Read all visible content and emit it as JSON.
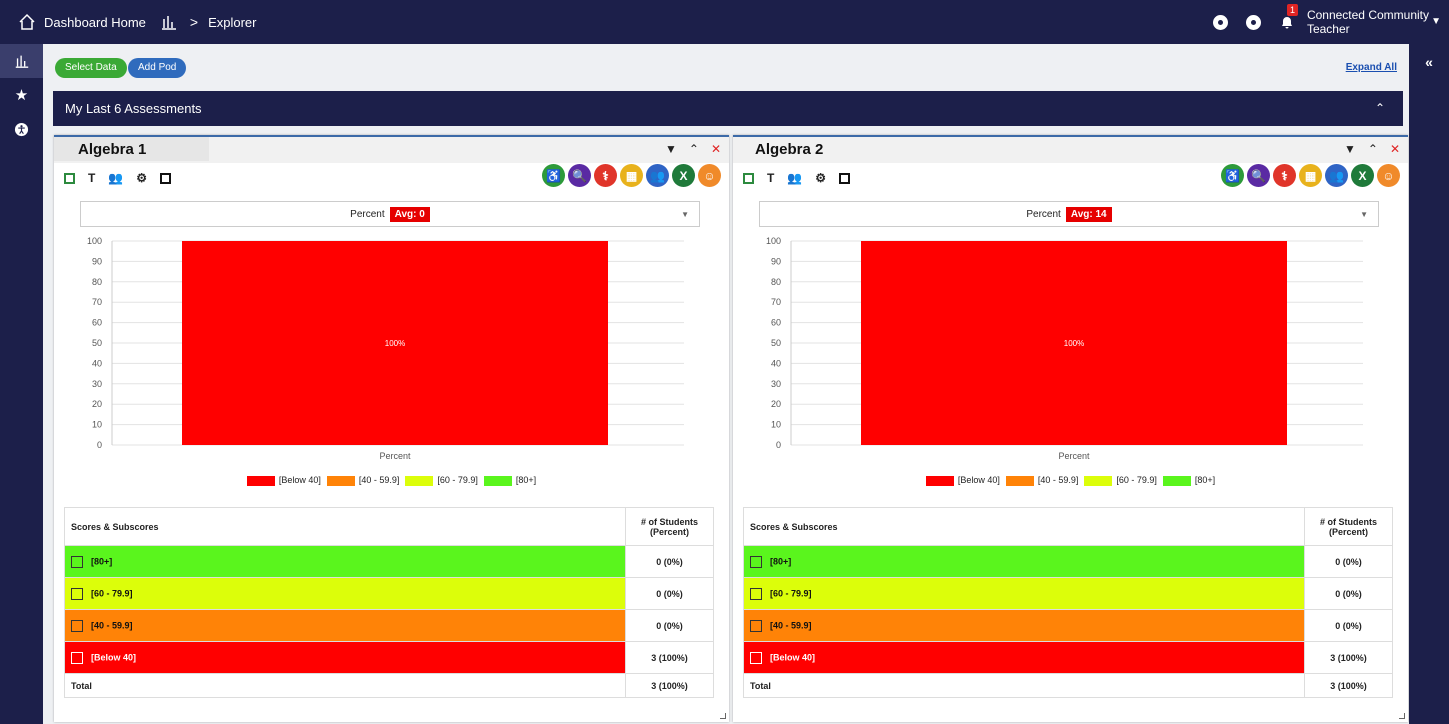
{
  "topbar": {
    "home_label": "Dashboard Home",
    "chevron": ">",
    "current": "Explorer",
    "notification_count": "1",
    "user_line1": "Connected Community",
    "user_line2": "Teacher"
  },
  "content": {
    "select_data_label": "Select Data",
    "add_pod_label": "Add Pod",
    "expand_all_label": "Expand All",
    "section_title": "My Last 6 Assessments"
  },
  "pods": [
    {
      "title": "Algebra 1",
      "dropdown_label": "Percent",
      "avg_label": "Avg: 0",
      "table": {
        "col1": "Scores & Subscores",
        "col2_line1": "# of Students",
        "col2_line2": "(Percent)",
        "rows": [
          {
            "label": "[80+]",
            "value": "0 (0%)",
            "color": "#5af51d"
          },
          {
            "label": "[60 - 79.9]",
            "value": "0 (0%)",
            "color": "#dcfe0a"
          },
          {
            "label": "[40 - 59.9]",
            "value": "0 (0%)",
            "color": "#ff8307"
          },
          {
            "label": "[Below 40]",
            "value": "3 (100%)",
            "color": "#ff0000"
          }
        ],
        "total_label": "Total",
        "total_value": "3 (100%)"
      }
    },
    {
      "title": "Algebra 2",
      "dropdown_label": "Percent",
      "avg_label": "Avg: 14",
      "table": {
        "col1": "Scores & Subscores",
        "col2_line1": "# of Students",
        "col2_line2": "(Percent)",
        "rows": [
          {
            "label": "[80+]",
            "value": "0 (0%)",
            "color": "#5af51d"
          },
          {
            "label": "[60 - 79.9]",
            "value": "0 (0%)",
            "color": "#dcfe0a"
          },
          {
            "label": "[40 - 59.9]",
            "value": "0 (0%)",
            "color": "#ff8307"
          },
          {
            "label": "[Below 40]",
            "value": "3 (100%)",
            "color": "#ff0000"
          }
        ],
        "total_label": "Total",
        "total_value": "3 (100%)"
      }
    }
  ],
  "legend": [
    {
      "label": "[Below 40]",
      "color": "#ff0000"
    },
    {
      "label": "[40 - 59.9]",
      "color": "#ff8307"
    },
    {
      "label": "[60 - 79.9]",
      "color": "#dcfe0a"
    },
    {
      "label": "[80+]",
      "color": "#5af51d"
    }
  ],
  "chart_data": [
    {
      "type": "bar",
      "categories": [
        "Percent"
      ],
      "series": [
        {
          "name": "[Below 40]",
          "values": [
            100
          ]
        },
        {
          "name": "[40 - 59.9]",
          "values": [
            0
          ]
        },
        {
          "name": "[60 - 79.9]",
          "values": [
            0
          ]
        },
        {
          "name": "[80+]",
          "values": [
            0
          ]
        }
      ],
      "stacked": true,
      "data_labels": [
        "100%"
      ],
      "xlabel": "Percent",
      "ylim": [
        0,
        100
      ],
      "yticks": [
        0,
        10,
        20,
        30,
        40,
        50,
        60,
        70,
        80,
        90,
        100
      ],
      "grid": true,
      "legend_position": "bottom"
    },
    {
      "type": "bar",
      "categories": [
        "Percent"
      ],
      "series": [
        {
          "name": "[Below 40]",
          "values": [
            100
          ]
        },
        {
          "name": "[40 - 59.9]",
          "values": [
            0
          ]
        },
        {
          "name": "[60 - 79.9]",
          "values": [
            0
          ]
        },
        {
          "name": "[80+]",
          "values": [
            0
          ]
        }
      ],
      "stacked": true,
      "data_labels": [
        "100%"
      ],
      "xlabel": "Percent",
      "ylim": [
        0,
        100
      ],
      "yticks": [
        0,
        10,
        20,
        30,
        40,
        50,
        60,
        70,
        80,
        90,
        100
      ],
      "grid": true,
      "legend_position": "bottom"
    }
  ],
  "toolbar_circle_icons": [
    {
      "name": "accessibility-icon",
      "color": "#2d9a3a"
    },
    {
      "name": "search-icon",
      "color": "#5a2aa3"
    },
    {
      "name": "stethoscope-icon",
      "color": "#e0352a"
    },
    {
      "name": "table-icon",
      "color": "#e8b21c"
    },
    {
      "name": "group-icon",
      "color": "#2f64c5"
    },
    {
      "name": "excel-icon",
      "color": "#1f7a3a"
    },
    {
      "name": "person-icon",
      "color": "#f08a2a"
    }
  ]
}
